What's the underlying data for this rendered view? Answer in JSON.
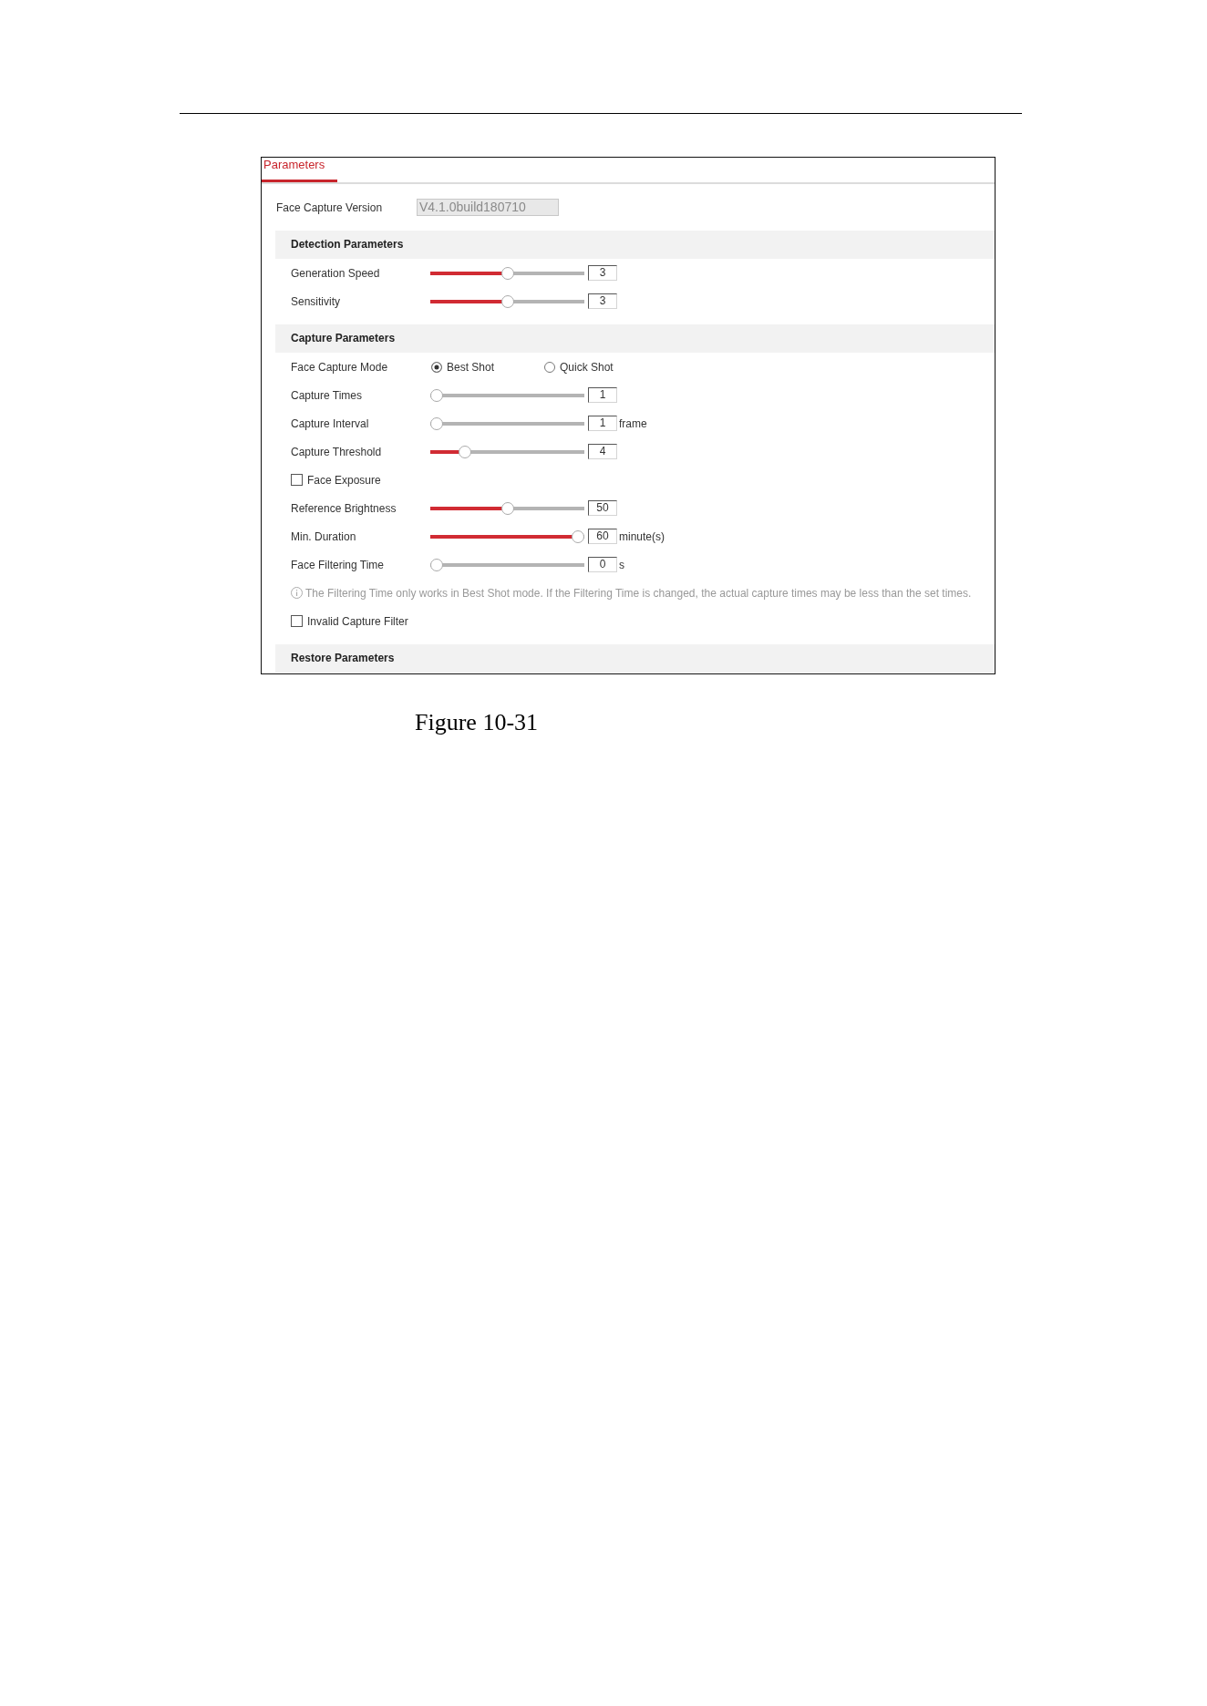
{
  "tabs": [
    {
      "label": "Parameters",
      "selected": true
    }
  ],
  "version": {
    "label": "Face Capture Version",
    "value": "V4.1.0build180710",
    "disabled": true
  },
  "sections": [
    {
      "title": "Detection Parameters",
      "rows": [
        {
          "kind": "slider",
          "label": "Generation Speed",
          "level": 0.5,
          "value": "3"
        },
        {
          "kind": "slider",
          "label": "Sensitivity",
          "level": 0.5,
          "value": "3"
        }
      ]
    },
    {
      "title": "Capture Parameters",
      "rows": [
        {
          "kind": "radio",
          "label": "Face Capture Mode",
          "options": [
            {
              "label": "Best Shot",
              "selected": true
            },
            {
              "label": "Quick Shot",
              "selected": false
            }
          ]
        },
        {
          "kind": "slider",
          "label": "Capture Times",
          "level": 0,
          "value": "1"
        },
        {
          "kind": "slider",
          "label": "Capture Interval",
          "level": 0,
          "value": "1",
          "unit": "frame"
        },
        {
          "kind": "slider",
          "label": "Capture Threshold",
          "level": 0.2,
          "value": "4"
        },
        {
          "kind": "checkbox",
          "label": "Face Exposure",
          "checked": false
        },
        {
          "kind": "slider",
          "label": "Reference Brightness",
          "level": 0.5,
          "value": "50"
        },
        {
          "kind": "slider",
          "label": "Min. Duration",
          "level": 1,
          "value": "60",
          "unit": "minute(s)"
        },
        {
          "kind": "slider",
          "label": "Face Filtering Time",
          "level": 0,
          "value": "0",
          "unit": "s"
        },
        {
          "kind": "note",
          "text": "The Filtering Time only works in Best Shot mode. If the Filtering Time is changed, the actual capture times may be less than the set times."
        },
        {
          "kind": "checkbox",
          "label": "Invalid Capture Filter",
          "checked": false
        }
      ]
    },
    {
      "title": "Restore Parameters"
    }
  ],
  "caption": "Figure 10-31"
}
